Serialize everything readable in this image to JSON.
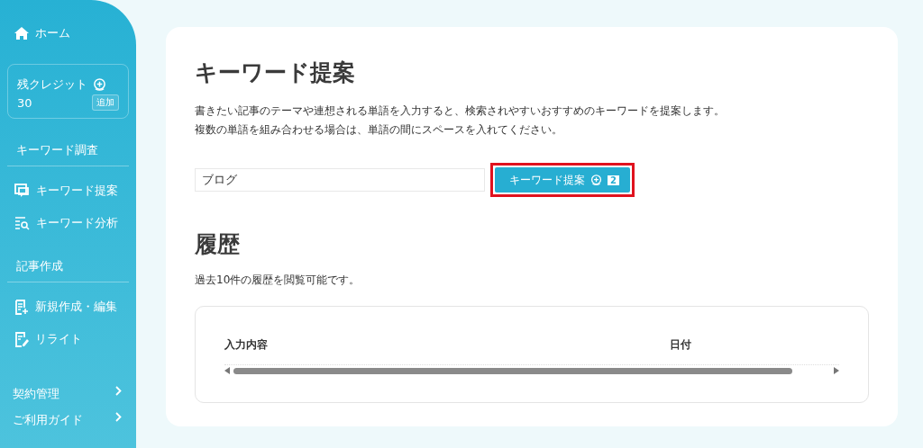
{
  "sidebar": {
    "home": "ホーム",
    "credit": {
      "label": "残クレジット",
      "value": "30",
      "add_button": "追加"
    },
    "sections": [
      {
        "heading": "キーワード調査",
        "items": [
          {
            "label": "キーワード提案"
          },
          {
            "label": "キーワード分析"
          }
        ]
      },
      {
        "heading": "記事作成",
        "items": [
          {
            "label": "新規作成・編集"
          },
          {
            "label": "リライト"
          }
        ]
      }
    ],
    "links": [
      "契約管理",
      "ご利用ガイド"
    ]
  },
  "main": {
    "title": "キーワード提案",
    "description": [
      "書きたい記事のテーマや連想される単語を入力すると、検索されやすいおすすめのキーワードを提案します。",
      "複数の単語を組み合わせる場合は、単語の間にスペースを入れてください。"
    ],
    "input": {
      "value": "ブログ"
    },
    "submit": {
      "label": "キーワード提案",
      "cost": "2",
      "highlighted": true
    },
    "history": {
      "title": "履歴",
      "note": "過去10件の履歴を閲覧可能です。",
      "columns": [
        "入力内容",
        "日付"
      ]
    }
  }
}
